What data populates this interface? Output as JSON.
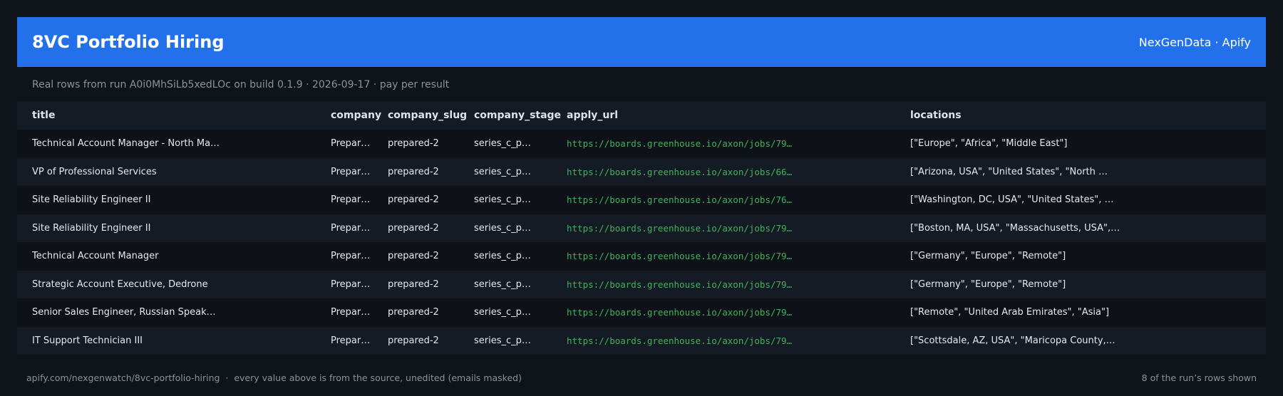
{
  "header": {
    "title": "8VC Portfolio Hiring",
    "brand": "NexGenData · Apify"
  },
  "subtitle": "Real rows from run A0i0MhSiLb5xedLOc on build 0.1.9 · 2026-09-17 · pay per result",
  "table": {
    "columns": [
      "title",
      "company",
      "company_slug",
      "company_stage",
      "apply_url",
      "locations"
    ],
    "rows": [
      {
        "title": "Technical Account Manager - North Ma…",
        "company": "Prepar…",
        "company_slug": "prepared-2",
        "company_stage": "series_c_p…",
        "apply_url": "https://boards.greenhouse.io/axon/jobs/79…",
        "locations": "[\"Europe\", \"Africa\", \"Middle East\"]"
      },
      {
        "title": "VP of Professional Services",
        "company": "Prepar…",
        "company_slug": "prepared-2",
        "company_stage": "series_c_p…",
        "apply_url": "https://boards.greenhouse.io/axon/jobs/66…",
        "locations": "[\"Arizona, USA\", \"United States\", \"North …"
      },
      {
        "title": "Site Reliability Engineer II",
        "company": "Prepar…",
        "company_slug": "prepared-2",
        "company_stage": "series_c_p…",
        "apply_url": "https://boards.greenhouse.io/axon/jobs/76…",
        "locations": "[\"Washington, DC, USA\", \"United States\", …"
      },
      {
        "title": "Site Reliability Engineer II",
        "company": "Prepar…",
        "company_slug": "prepared-2",
        "company_stage": "series_c_p…",
        "apply_url": "https://boards.greenhouse.io/axon/jobs/79…",
        "locations": "[\"Boston, MA, USA\", \"Massachusetts, USA\",…"
      },
      {
        "title": "Technical Account Manager",
        "company": "Prepar…",
        "company_slug": "prepared-2",
        "company_stage": "series_c_p…",
        "apply_url": "https://boards.greenhouse.io/axon/jobs/79…",
        "locations": "[\"Germany\", \"Europe\", \"Remote\"]"
      },
      {
        "title": "Strategic Account Executive, Dedrone",
        "company": "Prepar…",
        "company_slug": "prepared-2",
        "company_stage": "series_c_p…",
        "apply_url": "https://boards.greenhouse.io/axon/jobs/79…",
        "locations": "[\"Germany\", \"Europe\", \"Remote\"]"
      },
      {
        "title": "Senior Sales Engineer, Russian Speak…",
        "company": "Prepar…",
        "company_slug": "prepared-2",
        "company_stage": "series_c_p…",
        "apply_url": "https://boards.greenhouse.io/axon/jobs/79…",
        "locations": "[\"Remote\", \"United Arab Emirates\", \"Asia\"]"
      },
      {
        "title": "IT Support Technician III",
        "company": "Prepar…",
        "company_slug": "prepared-2",
        "company_stage": "series_c_p…",
        "apply_url": "https://boards.greenhouse.io/axon/jobs/79…",
        "locations": "[\"Scottsdale, AZ, USA\", \"Maricopa County,…"
      }
    ]
  },
  "footer": {
    "left": "apify.com/nexgenwatch/8vc-portfolio-hiring  ·  every value above is from the source, unedited (emails masked)",
    "right": "8 of the run’s rows shown"
  },
  "colors": {
    "background": "#0f131a",
    "header": "#2271ea",
    "url": "#3fb35a"
  }
}
